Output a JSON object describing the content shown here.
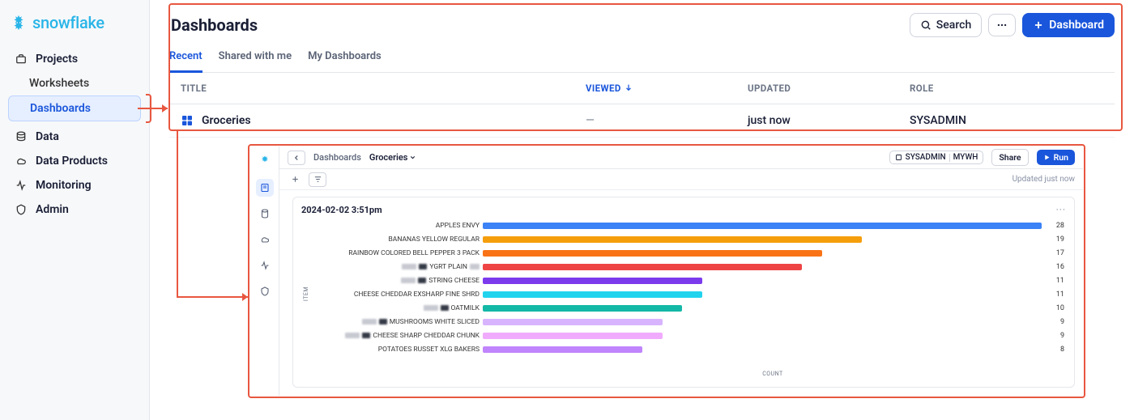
{
  "brand": "snowflake",
  "sidebar": {
    "items": [
      {
        "label": "Projects",
        "icon": "projects"
      },
      {
        "label": "Worksheets",
        "sub": true
      },
      {
        "label": "Dashboards",
        "sub": true,
        "active": true
      },
      {
        "label": "Data",
        "icon": "data"
      },
      {
        "label": "Data Products",
        "icon": "cloud"
      },
      {
        "label": "Monitoring",
        "icon": "activity"
      },
      {
        "label": "Admin",
        "icon": "shield"
      }
    ]
  },
  "header": {
    "title": "Dashboards",
    "search_label": "Search",
    "new_label": "Dashboard"
  },
  "tabs": [
    {
      "label": "Recent",
      "active": true
    },
    {
      "label": "Shared with me"
    },
    {
      "label": "My Dashboards"
    }
  ],
  "columns": {
    "title": "TITLE",
    "viewed": "VIEWED",
    "updated": "UPDATED",
    "role": "ROLE"
  },
  "rows": [
    {
      "title": "Groceries",
      "viewed": "—",
      "updated": "just now",
      "role": "SYSADMIN"
    }
  ],
  "inset": {
    "breadcrumb": {
      "parent": "Dashboards",
      "current": "Groceries"
    },
    "context": {
      "role": "SYSADMIN",
      "warehouse": "MYWH"
    },
    "share_label": "Share",
    "run_label": "Run",
    "updated_text": "Updated just now",
    "card_title": "2024-02-02 3:51pm",
    "xlabel": "COUNT",
    "ylabel": "ITEM"
  },
  "chart_data": {
    "type": "bar",
    "orientation": "horizontal",
    "title": "2024-02-02 3:51pm",
    "xlabel": "COUNT",
    "ylabel": "ITEM",
    "categories": [
      "APPLES ENVY",
      "BANANAS YELLOW REGULAR",
      "RAINBOW COLORED BELL PEPPER 3 PACK",
      "YGRT PLAIN",
      "STRING CHEESE",
      "CHEESE CHEDDAR EXSHARP FINE SHRD",
      "OATMILK",
      "MUSHROOMS WHITE SLICED",
      "CHEESE SHARP CHEDDAR CHUNK",
      "POTATOES RUSSET XLG BAKERS"
    ],
    "values": [
      28,
      19,
      17,
      16,
      11,
      11,
      10,
      9,
      9,
      8
    ],
    "colors": [
      "#3b82f6",
      "#f59e0b",
      "#f97316",
      "#ef4444",
      "#7c3aed",
      "#22d3ee",
      "#14b8a6",
      "#d8b4fe",
      "#f0abfc",
      "#c084fc"
    ],
    "partial_obscured": [
      false,
      false,
      false,
      true,
      true,
      false,
      true,
      true,
      true,
      false
    ],
    "xlim": [
      0,
      28
    ]
  }
}
